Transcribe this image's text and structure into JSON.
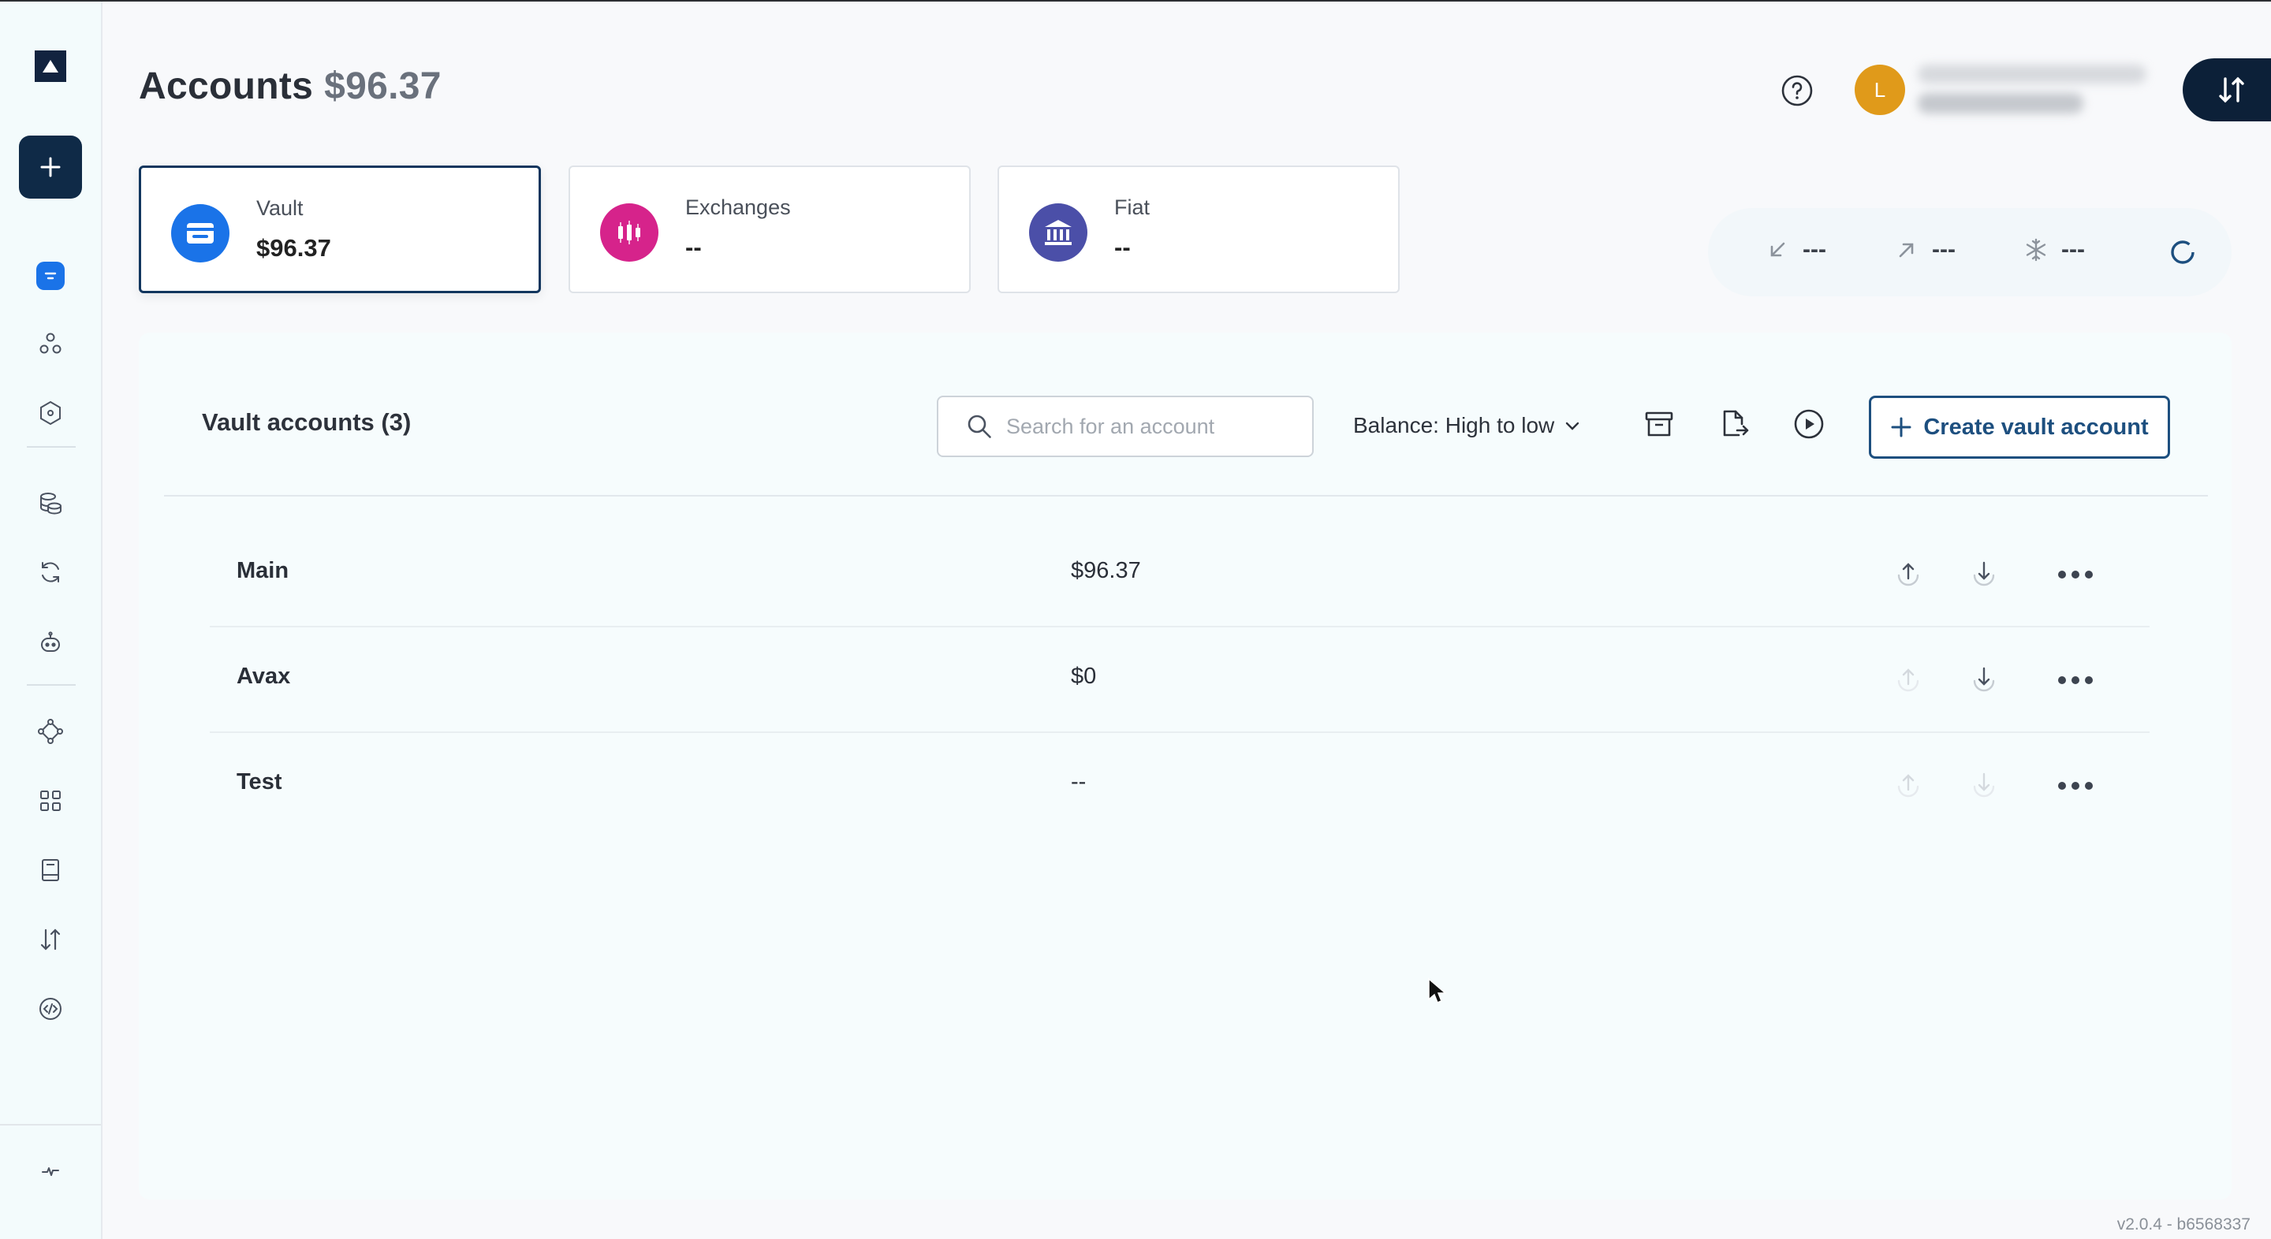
{
  "page": {
    "title": "Accounts",
    "total_balance": "$96.37",
    "help_icon": "question-circle-icon",
    "user_initial": "L",
    "version": "v2.0.4 - b6568337"
  },
  "sidebar": {
    "items": [
      {
        "icon": "logo-icon"
      },
      {
        "icon": "plus-icon",
        "label": "New"
      },
      {
        "icon": "accounts-icon",
        "active": true
      },
      {
        "icon": "network-icon"
      },
      {
        "icon": "hexagon-icon"
      },
      {
        "icon": "coins-icon"
      },
      {
        "icon": "refresh-icon"
      },
      {
        "icon": "robot-icon"
      },
      {
        "icon": "diamond-network-icon"
      },
      {
        "icon": "apps-grid-icon"
      },
      {
        "icon": "book-icon"
      },
      {
        "icon": "transfer-icon"
      },
      {
        "icon": "developer-icon"
      },
      {
        "icon": "activity-icon"
      }
    ]
  },
  "cards": [
    {
      "label": "Vault",
      "value": "$96.37",
      "color": "#1a73e8"
    },
    {
      "label": "Exchanges",
      "value": "--",
      "color": "#d6238b"
    },
    {
      "label": "Fiat",
      "value": "--",
      "color": "#4b4fa8"
    }
  ],
  "summary": {
    "incoming": "---",
    "outgoing": "---",
    "frozen": "---"
  },
  "vault": {
    "title": "Vault accounts (3)",
    "search_placeholder": "Search for an account",
    "sort_label": "Balance: High to low",
    "create_label": "Create vault account",
    "rows": [
      {
        "name": "Main",
        "balance": "$96.37",
        "withdraw_enabled": true,
        "deposit_enabled": true
      },
      {
        "name": "Avax",
        "balance": "$0",
        "withdraw_enabled": false,
        "deposit_enabled": true
      },
      {
        "name": "Test",
        "balance": "--",
        "withdraw_enabled": false,
        "deposit_enabled": false
      }
    ]
  }
}
